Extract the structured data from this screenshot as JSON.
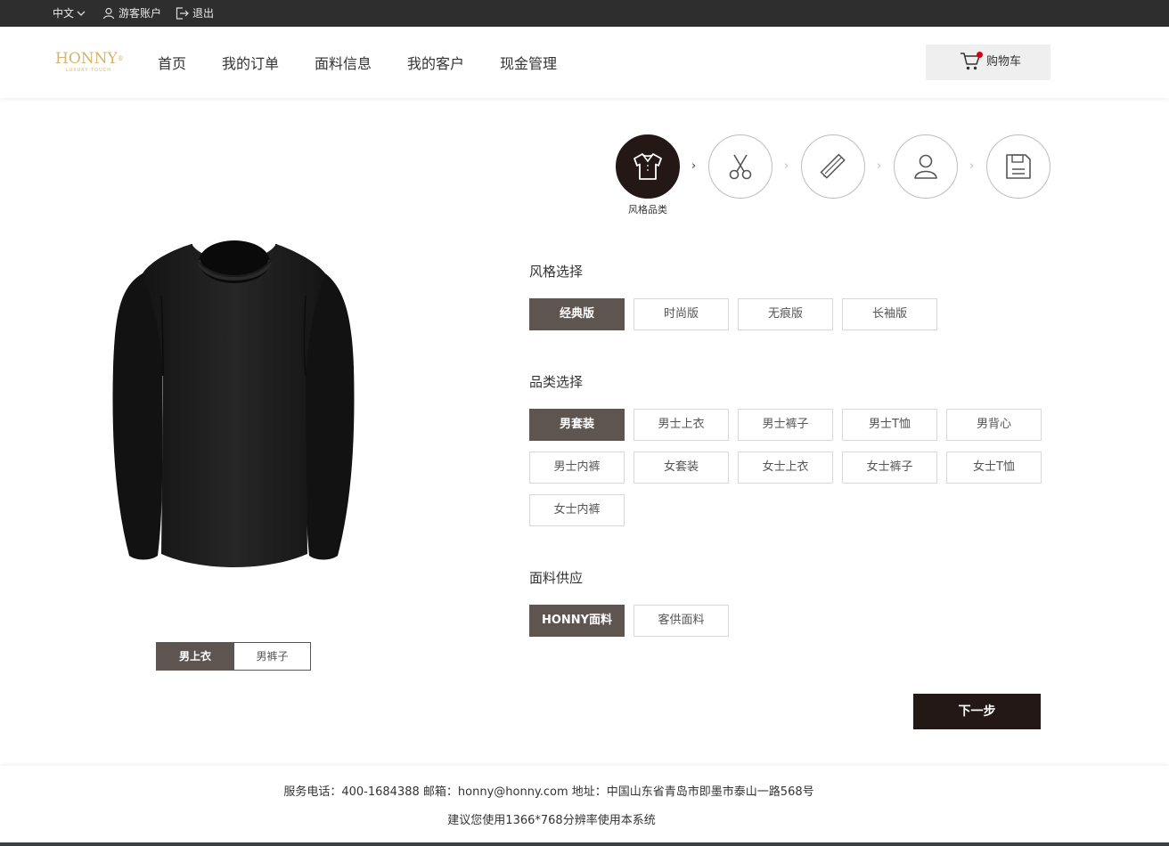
{
  "topbar": {
    "language": "中文",
    "guest_account": "游客账户",
    "logout": "退出"
  },
  "header": {
    "logo_text": "HONNY",
    "logo_reg": "®",
    "logo_sub": "LUXURY TOUCH",
    "nav": [
      "首页",
      "我的订单",
      "面料信息",
      "我的客户",
      "现金管理"
    ],
    "cart_label": "购物车"
  },
  "steps": {
    "active_label": "风格品类",
    "icons": [
      "shirt-icon",
      "scissors-icon",
      "ruler-pencil-icon",
      "user-icon",
      "save-icon"
    ]
  },
  "style_section": {
    "title": "风格选择",
    "options": [
      "经典版",
      "时尚版",
      "无痕版",
      "长袖版"
    ],
    "selected": "经典版"
  },
  "category_section": {
    "title": "品类选择",
    "options": [
      "男套装",
      "男士上衣",
      "男士裤子",
      "男士T恤",
      "男背心",
      "男士内裤",
      "女套装",
      "女士上衣",
      "女士裤子",
      "女士T恤",
      "女士内裤"
    ],
    "selected": "男套装"
  },
  "fabric_section": {
    "title": "面料供应",
    "options": [
      "HONNY面料",
      "客供面料"
    ],
    "selected": "HONNY面料"
  },
  "preview_toggle": {
    "options": [
      "男上衣",
      "男裤子"
    ],
    "selected": "男上衣"
  },
  "next_button": "下一步",
  "footer": {
    "contact": "服务电话：400-1684388 邮箱：honny@honny.com 地址：中国山东省青岛市即墨市泰山一路568号",
    "tip": "建议您使用1366*768分辨率使用本系统"
  },
  "colors": {
    "topbar": "#2e2e2e",
    "accent_dark": "#231815",
    "selected_option": "#5e5550",
    "logo_gold": "#d8b36a",
    "cart_dot": "#d0021b"
  }
}
